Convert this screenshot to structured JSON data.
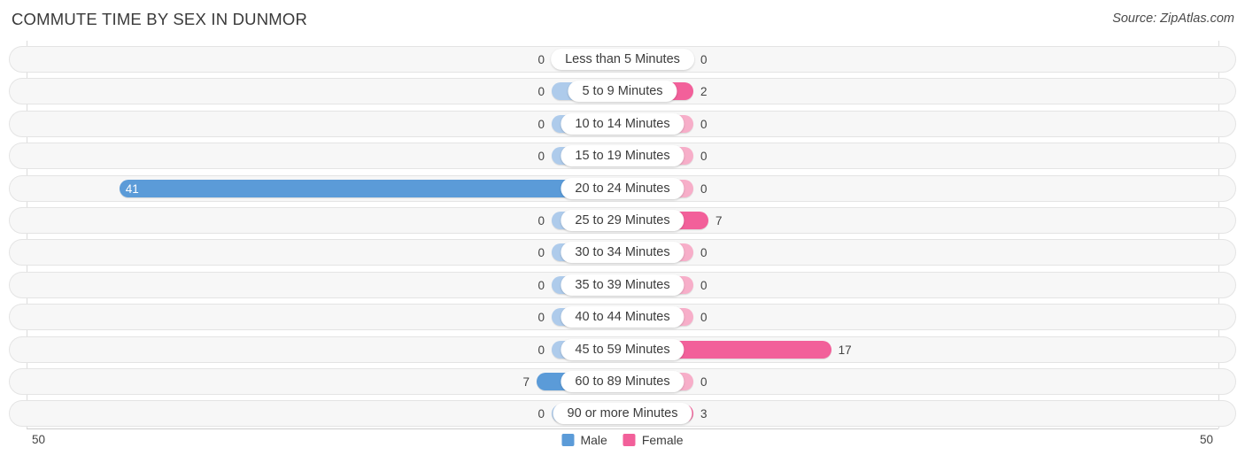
{
  "header": {
    "title": "COMMUTE TIME BY SEX IN DUNMOR",
    "source": "Source: ZipAtlas.com"
  },
  "legend": {
    "male": {
      "label": "Male",
      "color": "#5b9bd8"
    },
    "female": {
      "label": "Female",
      "color": "#f2609a"
    }
  },
  "axis": {
    "left_tick": "50",
    "right_tick": "50",
    "max": 50
  },
  "colors": {
    "male_light": "#aecbeb",
    "male_strong": "#5b9bd8",
    "female_light": "#f7aec9",
    "female_strong": "#f2609a",
    "row_background": "#f7f7f7",
    "row_border": "#e4e4e4",
    "gridline": "#dcdcdc"
  },
  "chart_data": {
    "type": "bar",
    "orientation": "horizontal-diverging",
    "title": "COMMUTE TIME BY SEX IN DUNMOR",
    "xlabel": "",
    "ylabel": "",
    "xlim": [
      50,
      50
    ],
    "grid": true,
    "legend_position": "bottom-center",
    "categories": [
      "Less than 5 Minutes",
      "5 to 9 Minutes",
      "10 to 14 Minutes",
      "15 to 19 Minutes",
      "20 to 24 Minutes",
      "25 to 29 Minutes",
      "30 to 34 Minutes",
      "35 to 39 Minutes",
      "40 to 44 Minutes",
      "45 to 59 Minutes",
      "60 to 89 Minutes",
      "90 or more Minutes"
    ],
    "series": [
      {
        "name": "Male",
        "values": [
          0,
          0,
          0,
          0,
          41,
          0,
          0,
          0,
          0,
          0,
          7,
          0
        ]
      },
      {
        "name": "Female",
        "values": [
          0,
          2,
          0,
          0,
          0,
          7,
          0,
          0,
          0,
          17,
          0,
          3
        ]
      }
    ]
  },
  "rows": [
    {
      "label": "Less than 5 Minutes",
      "male": "0",
      "female": "0"
    },
    {
      "label": "5 to 9 Minutes",
      "male": "0",
      "female": "2"
    },
    {
      "label": "10 to 14 Minutes",
      "male": "0",
      "female": "0"
    },
    {
      "label": "15 to 19 Minutes",
      "male": "0",
      "female": "0"
    },
    {
      "label": "20 to 24 Minutes",
      "male": "41",
      "female": "0"
    },
    {
      "label": "25 to 29 Minutes",
      "male": "0",
      "female": "7"
    },
    {
      "label": "30 to 34 Minutes",
      "male": "0",
      "female": "0"
    },
    {
      "label": "35 to 39 Minutes",
      "male": "0",
      "female": "0"
    },
    {
      "label": "40 to 44 Minutes",
      "male": "0",
      "female": "0"
    },
    {
      "label": "45 to 59 Minutes",
      "male": "0",
      "female": "17"
    },
    {
      "label": "60 to 89 Minutes",
      "male": "7",
      "female": "0"
    },
    {
      "label": "90 or more Minutes",
      "male": "0",
      "female": "3"
    }
  ]
}
